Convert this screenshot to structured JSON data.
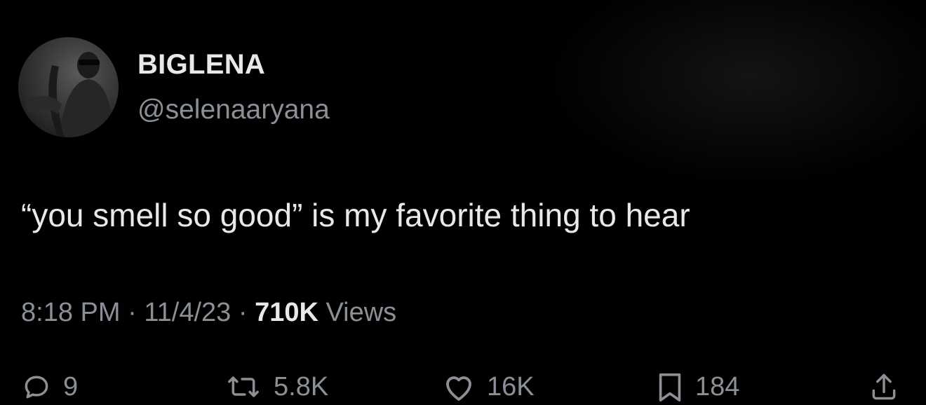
{
  "user": {
    "display_name": "BIGLENA",
    "handle": "@selenaaryana"
  },
  "tweet": {
    "text": "“you smell so good” is my favorite thing to hear"
  },
  "meta": {
    "time": "8:18 PM",
    "separator": "·",
    "date": "11/4/23",
    "views_count": "710K",
    "views_label": "Views"
  },
  "actions": {
    "replies": "9",
    "retweets": "5.8K",
    "likes": "16K",
    "bookmarks": "184"
  },
  "icons": {
    "reply": "reply-icon",
    "retweet": "retweet-icon",
    "like": "heart-icon",
    "bookmark": "bookmark-icon",
    "share": "share-icon"
  },
  "colors": {
    "background": "#000000",
    "primary_text": "#e7e9ea",
    "secondary_text": "#8b9096"
  }
}
